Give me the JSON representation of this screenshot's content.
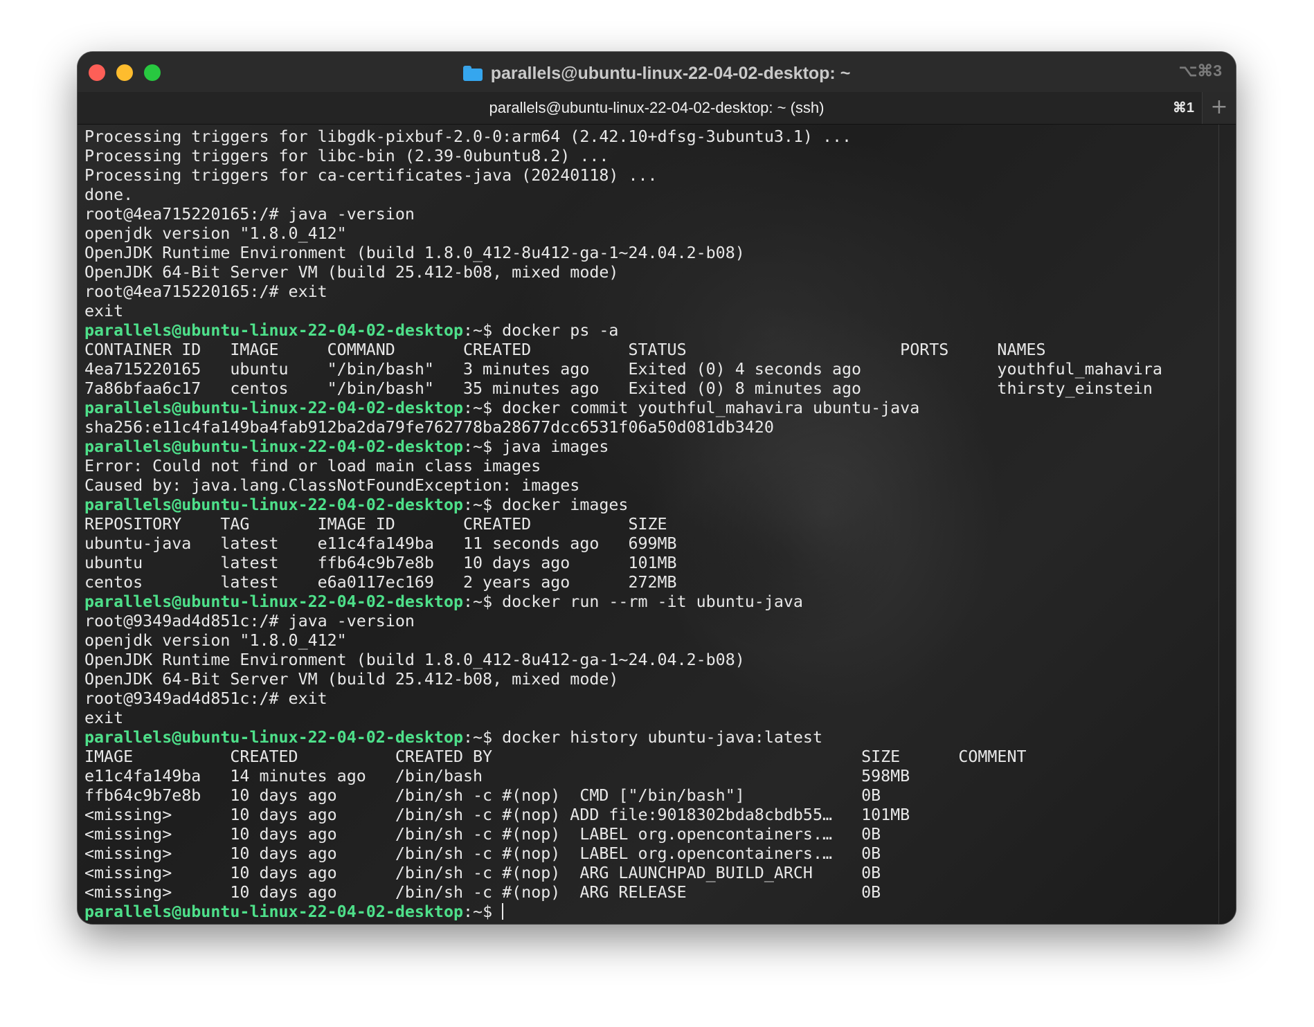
{
  "window": {
    "title": "parallels@ubuntu-linux-22-04-02-desktop: ~",
    "title_shortcut": "⌥⌘3",
    "folder_icon": "folder-icon",
    "traffic_lights": {
      "close": "#fe5f57",
      "minimize": "#febc2e",
      "maximize": "#28c840"
    }
  },
  "tabs": [
    {
      "label": "parallels@ubuntu-linux-22-04-02-desktop: ~ (ssh)",
      "shortcut": "⌘1"
    }
  ],
  "new_tab_label": "+",
  "prompt": {
    "user_host": "parallels@ubuntu-linux-22-04-02-desktop",
    "path": ":~$",
    "color": "#4ee08a"
  },
  "lines": [
    {
      "text": "Processing triggers for libgdk-pixbuf-2.0-0:arm64 (2.42.10+dfsg-3ubuntu3.1) ..."
    },
    {
      "text": "Processing triggers for libc-bin (2.39-0ubuntu8.2) ..."
    },
    {
      "text": "Processing triggers for ca-certificates-java (20240118) ..."
    },
    {
      "text": "done."
    },
    {
      "text": "root@4ea715220165:/# java -version"
    },
    {
      "text": "openjdk version \"1.8.0_412\""
    },
    {
      "text": "OpenJDK Runtime Environment (build 1.8.0_412-8u412-ga-1~24.04.2-b08)"
    },
    {
      "text": "OpenJDK 64-Bit Server VM (build 25.412-b08, mixed mode)"
    },
    {
      "text": "root@4ea715220165:/# exit"
    },
    {
      "text": "exit"
    },
    {
      "prompt": true,
      "text": " docker ps -a"
    },
    {
      "text": "CONTAINER ID   IMAGE     COMMAND       CREATED          STATUS                      PORTS     NAMES"
    },
    {
      "text": "4ea715220165   ubuntu    \"/bin/bash\"   3 minutes ago    Exited (0) 4 seconds ago              youthful_mahavira"
    },
    {
      "text": "7a86bfaa6c17   centos    \"/bin/bash\"   35 minutes ago   Exited (0) 8 minutes ago              thirsty_einstein"
    },
    {
      "prompt": true,
      "text": " docker commit youthful_mahavira ubuntu-java"
    },
    {
      "text": "sha256:e11c4fa149ba4fab912ba2da79fe762778ba28677dcc6531f06a50d081db3420"
    },
    {
      "prompt": true,
      "text": " java images"
    },
    {
      "text": "Error: Could not find or load main class images"
    },
    {
      "text": "Caused by: java.lang.ClassNotFoundException: images"
    },
    {
      "prompt": true,
      "text": " docker images"
    },
    {
      "text": "REPOSITORY    TAG       IMAGE ID       CREATED          SIZE"
    },
    {
      "text": "ubuntu-java   latest    e11c4fa149ba   11 seconds ago   699MB"
    },
    {
      "text": "ubuntu        latest    ffb64c9b7e8b   10 days ago      101MB"
    },
    {
      "text": "centos        latest    e6a0117ec169   2 years ago      272MB"
    },
    {
      "prompt": true,
      "text": " docker run --rm -it ubuntu-java"
    },
    {
      "text": "root@9349ad4d851c:/# java -version"
    },
    {
      "text": "openjdk version \"1.8.0_412\""
    },
    {
      "text": "OpenJDK Runtime Environment (build 1.8.0_412-8u412-ga-1~24.04.2-b08)"
    },
    {
      "text": "OpenJDK 64-Bit Server VM (build 25.412-b08, mixed mode)"
    },
    {
      "text": "root@9349ad4d851c:/# exit"
    },
    {
      "text": "exit"
    },
    {
      "prompt": true,
      "text": " docker history ubuntu-java:latest"
    },
    {
      "text": "IMAGE          CREATED          CREATED BY                                      SIZE      COMMENT"
    },
    {
      "text": "e11c4fa149ba   14 minutes ago   /bin/bash                                       598MB"
    },
    {
      "text": "ffb64c9b7e8b   10 days ago      /bin/sh -c #(nop)  CMD [\"/bin/bash\"]            0B"
    },
    {
      "text": "<missing>      10 days ago      /bin/sh -c #(nop) ADD file:9018302bda8cbdb55…   101MB"
    },
    {
      "text": "<missing>      10 days ago      /bin/sh -c #(nop)  LABEL org.opencontainers.…   0B"
    },
    {
      "text": "<missing>      10 days ago      /bin/sh -c #(nop)  LABEL org.opencontainers.…   0B"
    },
    {
      "text": "<missing>      10 days ago      /bin/sh -c #(nop)  ARG LAUNCHPAD_BUILD_ARCH     0B"
    },
    {
      "text": "<missing>      10 days ago      /bin/sh -c #(nop)  ARG RELEASE                  0B"
    },
    {
      "prompt": true,
      "text": " ",
      "cursor": true
    }
  ]
}
